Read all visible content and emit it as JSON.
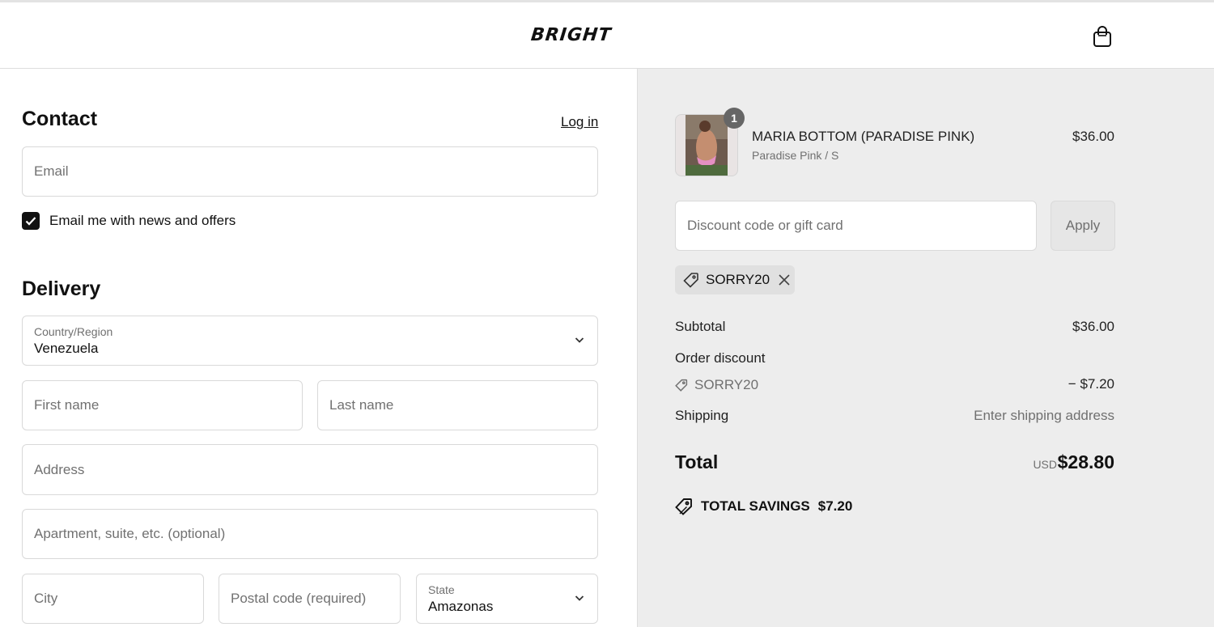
{
  "header": {
    "brand": "BRIGHT",
    "cart_icon": "shopping-bag-icon"
  },
  "contact": {
    "heading": "Contact",
    "login_link": "Log in",
    "email_placeholder": "Email",
    "newsletter_label": "Email me with news and offers",
    "newsletter_checked": true
  },
  "delivery": {
    "heading": "Delivery",
    "country_label": "Country/Region",
    "country_value": "Venezuela",
    "first_name_placeholder": "First name",
    "last_name_placeholder": "Last name",
    "address_placeholder": "Address",
    "apartment_placeholder": "Apartment, suite, etc. (optional)",
    "city_placeholder": "City",
    "postal_placeholder": "Postal code (required)",
    "state_label": "State",
    "state_value": "Amazonas"
  },
  "summary": {
    "item": {
      "quantity": "1",
      "name": "MARIA BOTTOM (PARADISE PINK)",
      "variant": "Paradise Pink / S",
      "price": "$36.00"
    },
    "discount_placeholder": "Discount code or gift card",
    "apply_label": "Apply",
    "applied_code": "SORRY20",
    "subtotal_label": "Subtotal",
    "subtotal_value": "$36.00",
    "order_discount_label": "Order discount",
    "order_discount_code": "SORRY20",
    "order_discount_value": "− $7.20",
    "shipping_label": "Shipping",
    "shipping_value": "Enter shipping address",
    "total_label": "Total",
    "total_currency": "USD",
    "total_value": "$28.80",
    "savings_label": "TOTAL SAVINGS",
    "savings_value": "$7.20"
  },
  "colors": {
    "summary_background": "#ededed",
    "text": "#111111",
    "muted": "#707070",
    "border": "#d9d9d9"
  }
}
